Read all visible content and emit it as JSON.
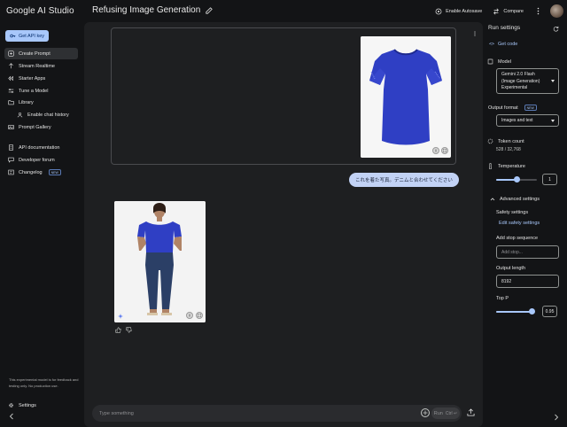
{
  "header": {
    "brand": "Google AI Studio",
    "prompt_title": "Refusing Image Generation",
    "autosave_label": "Enable Autosave",
    "compare_label": "Compare"
  },
  "sidebar": {
    "api_key_label": "Get API key",
    "items": [
      {
        "label": "Create Prompt",
        "icon": "plus-square-icon",
        "active": true
      },
      {
        "label": "Stream Realtime",
        "icon": "sparkle-icon"
      },
      {
        "label": "Starter Apps",
        "icon": "apps-icon"
      },
      {
        "label": "Tune a Model",
        "icon": "tune-icon"
      },
      {
        "label": "Library",
        "icon": "folder-icon"
      },
      {
        "label": "Enable chat history",
        "icon": "people-icon"
      },
      {
        "label": "Prompt Gallery",
        "icon": "gallery-icon"
      },
      {
        "label": "API documentation",
        "icon": "doc-icon"
      },
      {
        "label": "Developer forum",
        "icon": "forum-icon"
      },
      {
        "label": "Changelog",
        "icon": "changelog-icon"
      }
    ],
    "new_badge": "NEW",
    "disclaimer": "This experimental model is for feedback and testing only. No production use.",
    "settings_label": "Settings"
  },
  "chat": {
    "user_message": "これを着た写真。デニムと合わせてください",
    "input_placeholder": "Type something",
    "run_label": "Run",
    "run_shortcut": "Ctrl ↵"
  },
  "run_settings": {
    "title": "Run settings",
    "get_code": "Get code",
    "model_label": "Model",
    "model_value": "Gemini 2.0 Flash (Image Generation) Experimental",
    "output_format_label": "Output format",
    "output_format_badge": "NEW",
    "output_format_value": "Images and text",
    "token_count_label": "Token count",
    "token_count_value": "528 / 32,768",
    "temperature_label": "Temperature",
    "temperature_value": "1",
    "temperature_max": 2,
    "advanced_label": "Advanced settings",
    "safety_label": "Safety settings",
    "safety_link": "Edit safety settings",
    "stop_label": "Add stop sequence",
    "stop_placeholder": "Add stop...",
    "output_length_label": "Output length",
    "output_length_value": "8192",
    "top_p_label": "Top P",
    "top_p_value": "0.95"
  },
  "colors": {
    "accent": "#a8c7fa",
    "background": "#131416",
    "surface": "#1e1f21",
    "shirt_blue": "#2f3fc4"
  }
}
